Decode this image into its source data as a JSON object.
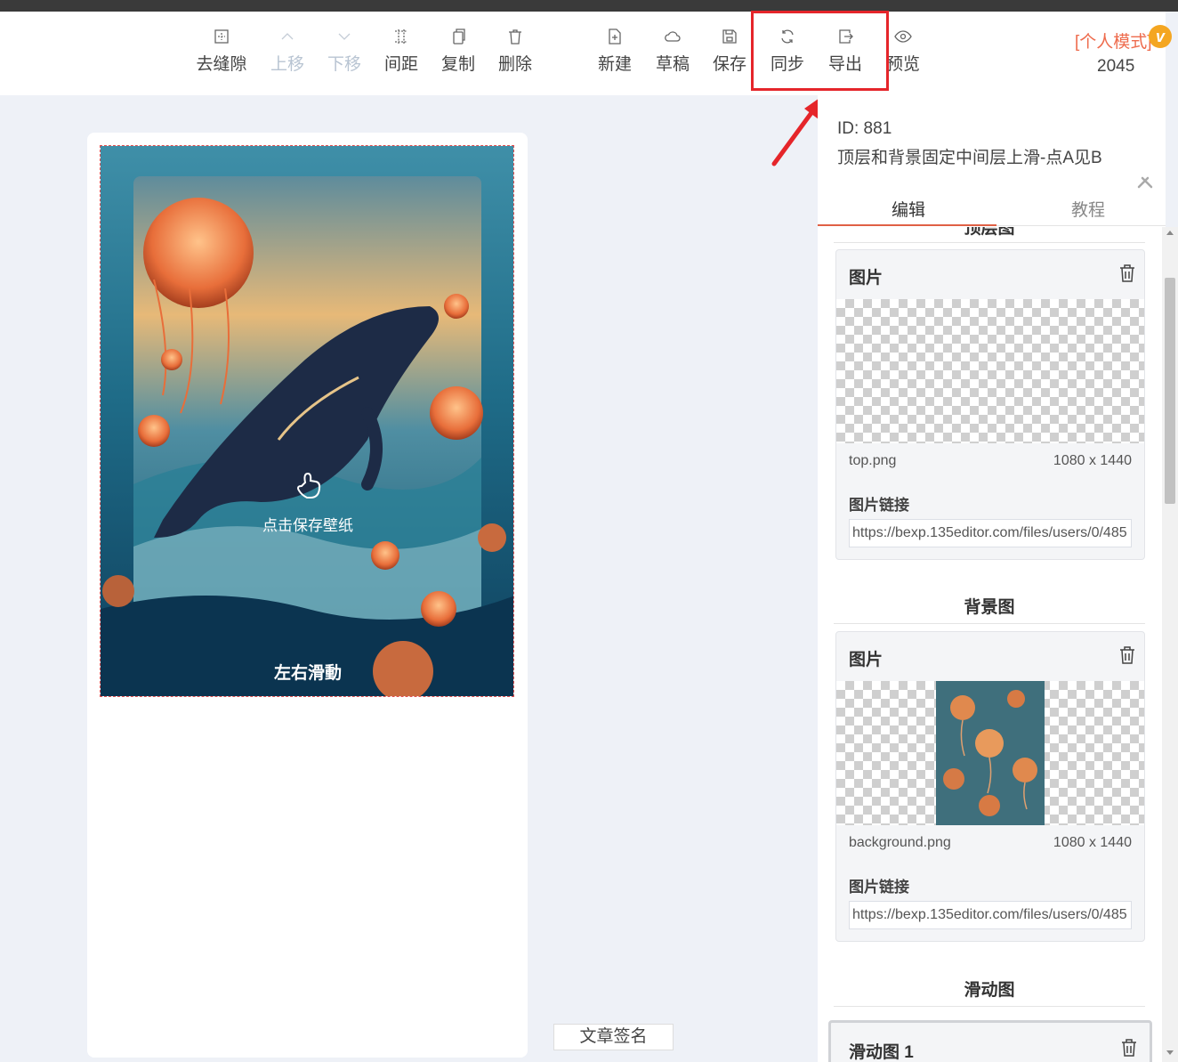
{
  "toolbar": {
    "items": [
      {
        "label": "去缝隙",
        "icon": "grid-box-icon",
        "enabled": true
      },
      {
        "label": "上移",
        "icon": "chevron-up-icon",
        "enabled": false
      },
      {
        "label": "下移",
        "icon": "chevron-down-icon",
        "enabled": false
      },
      {
        "label": "间距",
        "icon": "spacing-grid-icon",
        "enabled": true
      },
      {
        "label": "复制",
        "icon": "copy-icon",
        "enabled": true
      },
      {
        "label": "删除",
        "icon": "trash-icon",
        "enabled": true
      },
      {
        "label": "新建",
        "icon": "new-file-icon",
        "enabled": true
      },
      {
        "label": "草稿",
        "icon": "cloud-icon",
        "enabled": true
      },
      {
        "label": "保存",
        "icon": "save-icon",
        "enabled": true
      },
      {
        "label": "同步",
        "icon": "sync-icon",
        "enabled": true
      },
      {
        "label": "导出",
        "icon": "export-icon",
        "enabled": true
      },
      {
        "label": "预览",
        "icon": "eye-icon",
        "enabled": true
      }
    ],
    "mode_label": "[个人模式]",
    "mode_badge": "v",
    "count": "2045"
  },
  "canvas": {
    "overlay_tap_text": "点击保存壁纸",
    "overlay_swipe_text": "左右滑動",
    "signature_button": "文章签名"
  },
  "panel": {
    "id_text": "ID: 881",
    "template_name": "顶层和背景固定中间层上滑-点A见B",
    "tabs": {
      "edit": "编辑",
      "tutorial": "教程"
    },
    "top_section": {
      "title": "顶层图",
      "card_title": "图片",
      "file_name": "top.png",
      "file_size": "1080 x 1440",
      "link_label": "图片链接",
      "link_value": "https://bexp.135editor.com/files/users/0/485"
    },
    "bg_section": {
      "title": "背景图",
      "card_title": "图片",
      "file_name": "background.png",
      "file_size": "1080 x 1440",
      "link_label": "图片链接",
      "link_value": "https://bexp.135editor.com/files/users/0/485"
    },
    "slide_section": {
      "title": "滑动图",
      "card_title": "滑动图 1"
    }
  },
  "colors": {
    "accent": "#e06045",
    "highlight": "#e5252a",
    "mode": "#ee6b4d",
    "badge": "#f4a621"
  }
}
